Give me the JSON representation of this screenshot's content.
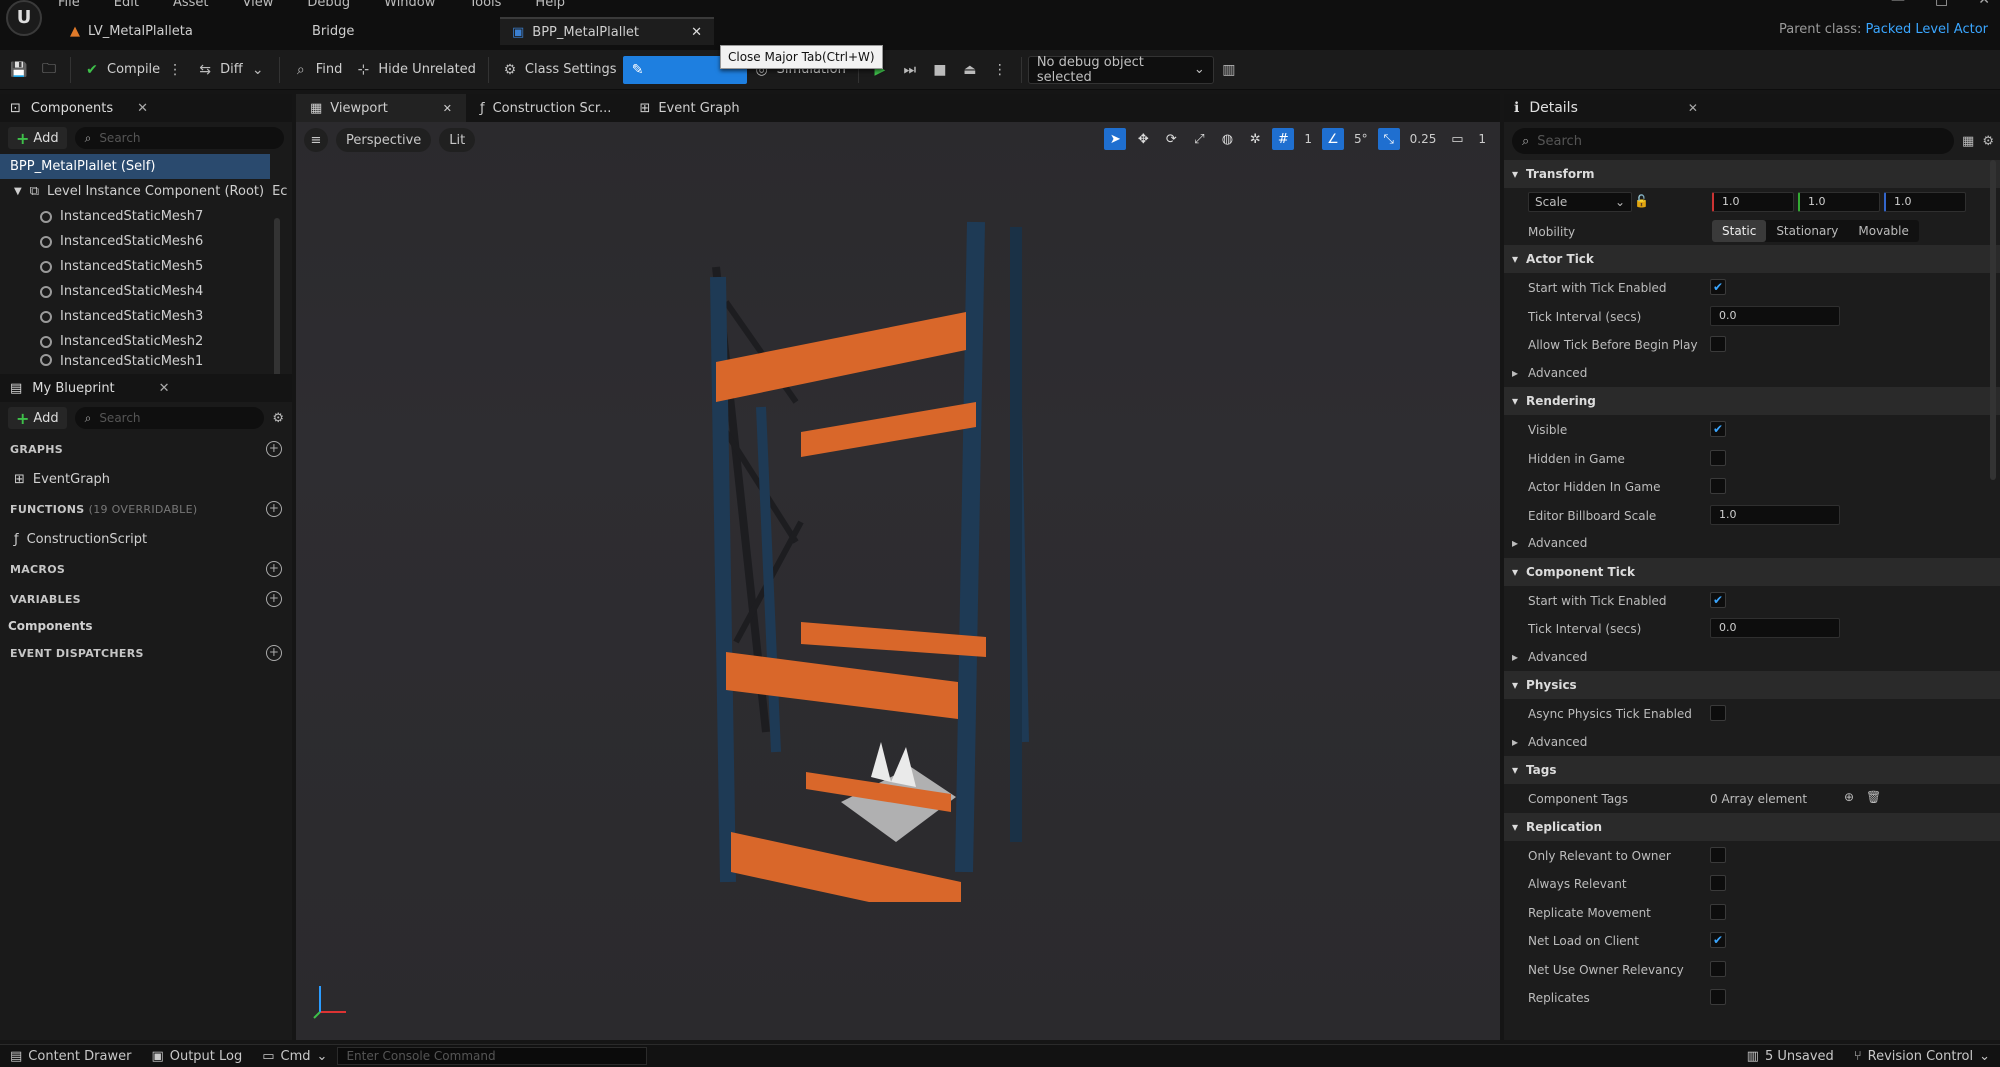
{
  "menu": [
    "File",
    "Edit",
    "Asset",
    "View",
    "Debug",
    "Window",
    "Tools",
    "Help"
  ],
  "tabs": [
    {
      "label": "LV_MetalPlalleta"
    },
    {
      "label": "Bridge"
    },
    {
      "label": "BPP_MetalPlallet"
    }
  ],
  "parent_class": {
    "label": "Parent class:",
    "value": "Packed Level Actor"
  },
  "tooltip": "Close Major Tab(Ctrl+W)",
  "toolbar": {
    "compile": "Compile",
    "diff": "Diff",
    "find": "Find",
    "hide_unrelated": "Hide Unrelated",
    "class_settings": "Class Settings",
    "simulation": "Simulation",
    "debug_object": "No debug object selected"
  },
  "components": {
    "tab": "Components",
    "add": "Add",
    "search_placeholder": "Search",
    "self": "BPP_MetalPlallet (Self)",
    "root": "Level Instance Component (Root)",
    "root_suffix": "Ec",
    "items": [
      "InstancedStaticMesh7",
      "InstancedStaticMesh6",
      "InstancedStaticMesh5",
      "InstancedStaticMesh4",
      "InstancedStaticMesh3",
      "InstancedStaticMesh2",
      "InstancedStaticMesh1"
    ]
  },
  "my_blueprint": {
    "tab": "My Blueprint",
    "add": "Add",
    "search_placeholder": "Search",
    "graphs": "GRAPHS",
    "event_graph": "EventGraph",
    "functions": "FUNCTIONS",
    "functions_sub": "(19 OVERRIDABLE)",
    "construction_script": "ConstructionScript",
    "macros": "MACROS",
    "variables": "VARIABLES",
    "components": "Components",
    "event_dispatchers": "EVENT DISPATCHERS"
  },
  "viewport": {
    "tabs": [
      "Viewport",
      "Construction Scr...",
      "Event Graph"
    ],
    "perspective": "Perspective",
    "lit": "Lit",
    "grid_value": "1",
    "angle_value": "5°",
    "scale_value": "0.25",
    "camera_value": "1"
  },
  "details": {
    "tab": "Details",
    "search_placeholder": "Search",
    "transform": "Transform",
    "scale_label": "Scale",
    "scale": [
      "1.0",
      "1.0",
      "1.0"
    ],
    "mobility": "Mobility",
    "mobility_options": [
      "Static",
      "Stationary",
      "Movable"
    ],
    "actor_tick": "Actor Tick",
    "start_with_tick": "Start with Tick Enabled",
    "tick_interval": "Tick Interval (secs)",
    "tick_interval_value": "0.0",
    "allow_tick": "Allow Tick Before Begin Play",
    "advanced": "Advanced",
    "rendering": "Rendering",
    "visible": "Visible",
    "hidden_in_game": "Hidden in Game",
    "actor_hidden": "Actor Hidden In Game",
    "billboard": "Editor Billboard Scale",
    "billboard_value": "1.0",
    "component_tick": "Component Tick",
    "physics": "Physics",
    "async_physics": "Async Physics Tick Enabled",
    "tags": "Tags",
    "component_tags": "Component Tags",
    "array_elements": "0 Array element",
    "replication": "Replication",
    "only_relevant": "Only Relevant to Owner",
    "always_relevant": "Always Relevant",
    "replicate_movement": "Replicate Movement",
    "net_load": "Net Load on Client",
    "net_use_owner": "Net Use Owner Relevancy",
    "replicates": "Replicates"
  },
  "bottom": {
    "content_drawer": "Content Drawer",
    "output_log": "Output Log",
    "cmd": "Cmd",
    "console_placeholder": "Enter Console Command",
    "unsaved": "5 Unsaved",
    "revision": "Revision Control"
  },
  "colors": {
    "accent": "#1e7fe0",
    "rack_orange": "#d9672a",
    "rack_blue": "#1e3a55"
  }
}
